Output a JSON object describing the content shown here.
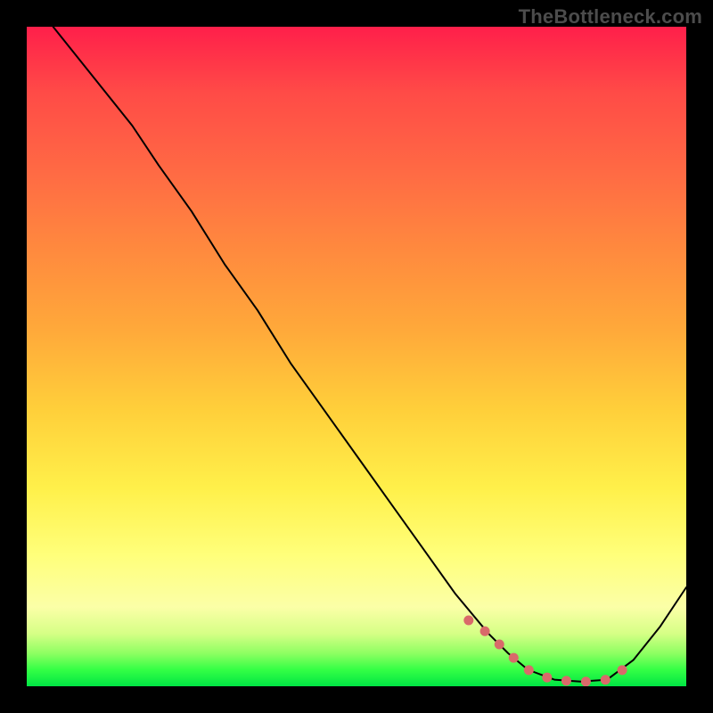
{
  "watermark": "TheBottleneck.com",
  "colors": {
    "frame_bg": "#000000",
    "curve": "#000000",
    "optimal_dots": "#d96a6a",
    "gradient_top": "#ff1f4a",
    "gradient_bottom": "#00e544"
  },
  "chart_data": {
    "type": "line",
    "title": "",
    "xlabel": "",
    "ylabel": "",
    "xlim": [
      0,
      100
    ],
    "ylim": [
      0,
      100
    ],
    "grid": false,
    "legend": false,
    "description": "Bottleneck curve: y≈bottleneck % vs x≈component balance. Curve falls from top-left toward a near-zero trough around x≈75–88, then rises. A dotted rose segment marks the near-zero (optimal) range.",
    "series": [
      {
        "name": "bottleneck_percent",
        "x": [
          4,
          8,
          12,
          16,
          20,
          25,
          30,
          35,
          40,
          45,
          50,
          55,
          60,
          65,
          70,
          73,
          76,
          80,
          84,
          88,
          92,
          96,
          100
        ],
        "y": [
          100,
          95,
          90,
          85,
          79,
          72,
          64,
          57,
          49,
          42,
          35,
          28,
          21,
          14,
          8,
          5,
          2.5,
          1,
          0.7,
          1,
          4,
          9,
          15
        ]
      }
    ],
    "optimal_range": {
      "x": [
        67,
        70,
        73,
        76,
        79,
        82,
        85,
        88,
        90,
        92
      ],
      "y": [
        10,
        8,
        5,
        2.5,
        1.3,
        0.8,
        0.7,
        1,
        2.2,
        4
      ]
    }
  }
}
